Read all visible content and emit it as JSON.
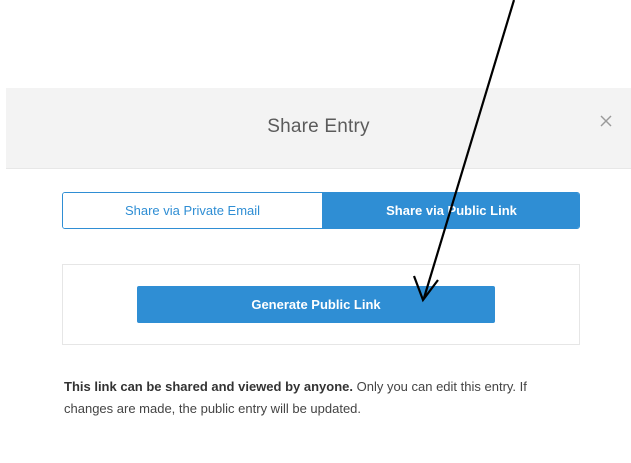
{
  "modal": {
    "title": "Share Entry",
    "close_icon": "close-icon"
  },
  "tabs": [
    {
      "label": "Share via Private Email",
      "active": false
    },
    {
      "label": "Share via Public Link",
      "active": true
    }
  ],
  "panel": {
    "generate_button_label": "Generate Public Link"
  },
  "note": {
    "bold_text": "This link can be shared and viewed by anyone.",
    "rest_text": " Only you can edit this entry. If changes are made, the public entry will be updated."
  },
  "colors": {
    "accent": "#2f8ed4",
    "header_bg": "#f3f3f3",
    "annotation": "#000000"
  }
}
